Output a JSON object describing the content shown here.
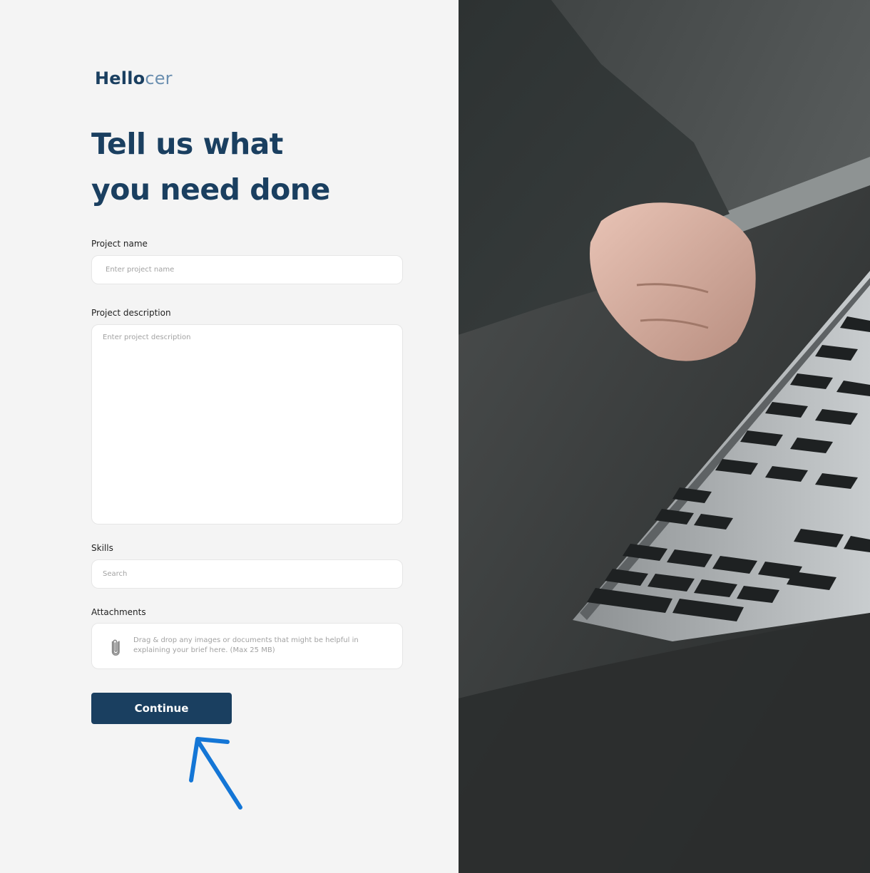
{
  "brand": {
    "part1": "Hello",
    "part2": "cer"
  },
  "headline": {
    "line1": "Tell us what",
    "line2": "you need done"
  },
  "form": {
    "project_name": {
      "label": "Project name",
      "placeholder": "Enter project name"
    },
    "project_description": {
      "label": "Project description",
      "placeholder": "Enter project description"
    },
    "skills": {
      "label": "Skills",
      "placeholder": "Search"
    },
    "attachments": {
      "label": "Attachments",
      "hint": "Drag & drop any images or documents that might be helpful in explaining your brief here. (Max 25 MB)",
      "icon": "paperclip-icon"
    },
    "continue_label": "Continue"
  },
  "colors": {
    "primary": "#1a3f60",
    "brand_light": "#6b8fb0",
    "background": "#f4f4f4",
    "annotation_arrow": "#1476d6"
  }
}
